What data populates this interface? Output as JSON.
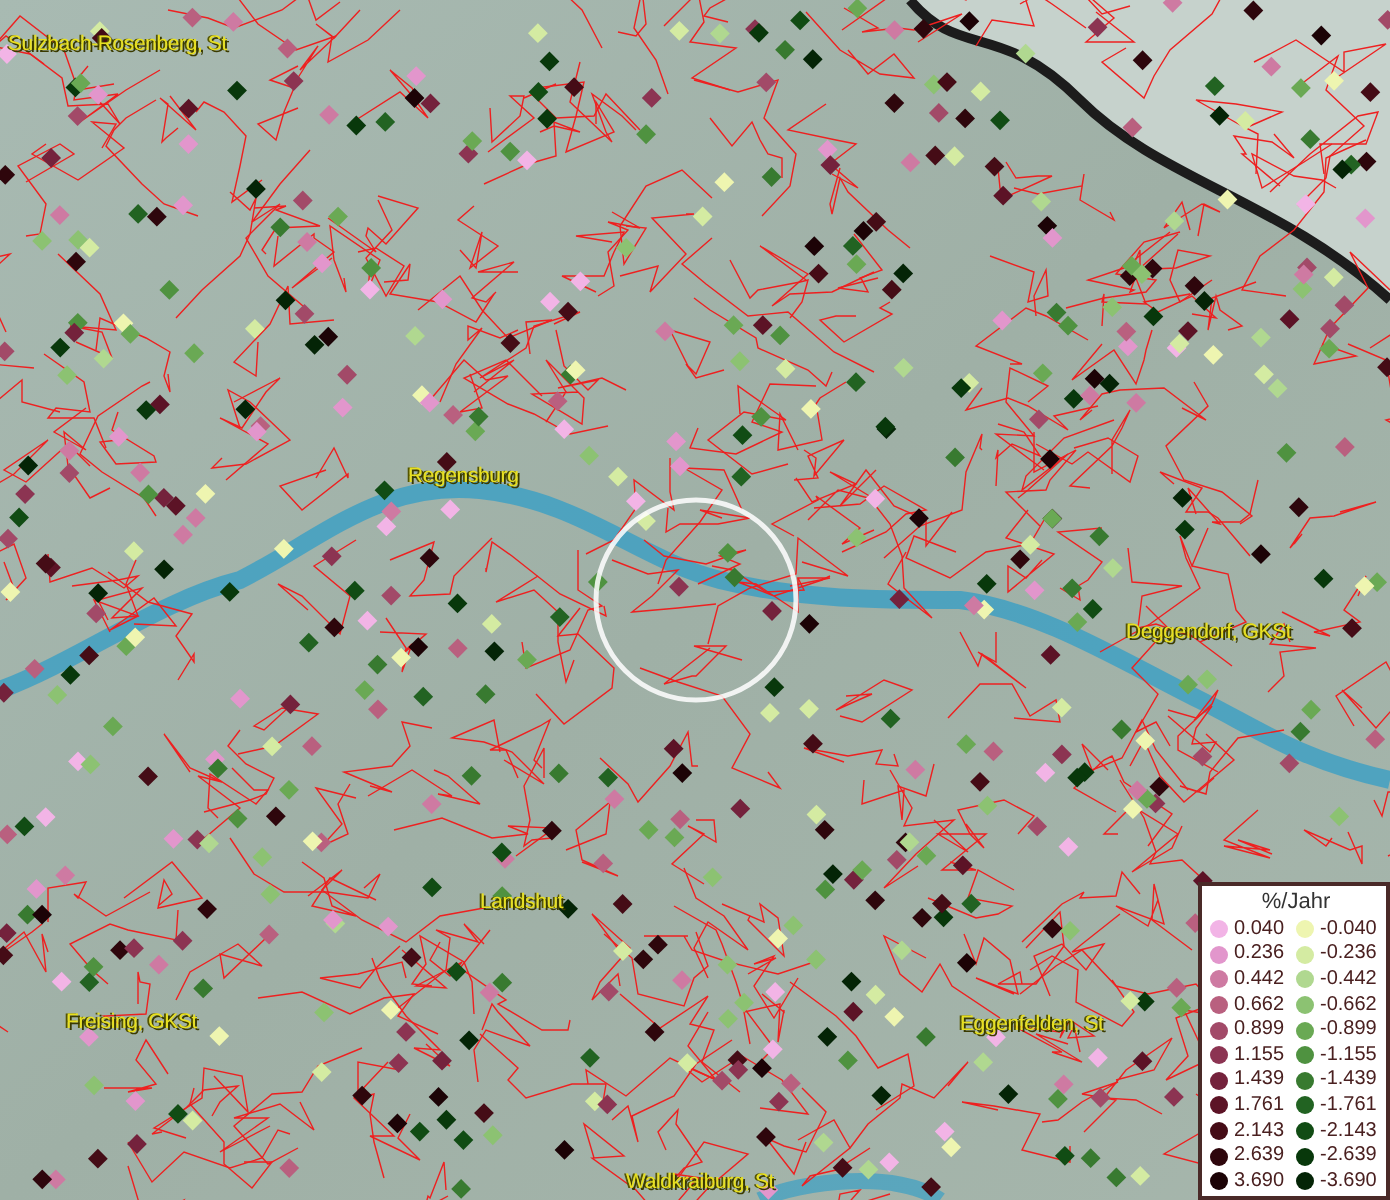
{
  "map": {
    "places": [
      {
        "name": "Sulzbach-Rosenberg, St"
      },
      {
        "name": "Regensburg"
      },
      {
        "name": "Deggendorf, GKSt"
      },
      {
        "name": "Landshut"
      },
      {
        "name": "Freising, GKSt"
      },
      {
        "name": "Eggenfelden, St"
      },
      {
        "name": "Waldkraiburg, St"
      }
    ]
  },
  "legend": {
    "title": "%/Jahr",
    "entries": [
      {
        "value": "0.040",
        "color": "#f2b4e6"
      },
      {
        "value": "-0.040",
        "color": "#eef5b0"
      },
      {
        "value": "0.236",
        "color": "#e296cc"
      },
      {
        "value": "-0.236",
        "color": "#d4eba2"
      },
      {
        "value": "0.442",
        "color": "#ce7aa2"
      },
      {
        "value": "-0.442",
        "color": "#b0d890"
      },
      {
        "value": "0.662",
        "color": "#b9607f"
      },
      {
        "value": "-0.662",
        "color": "#8cc272"
      },
      {
        "value": "0.899",
        "color": "#a24a68"
      },
      {
        "value": "-0.899",
        "color": "#6aa954"
      },
      {
        "value": "1.155",
        "color": "#8c3452"
      },
      {
        "value": "-1.155",
        "color": "#4f9240"
      },
      {
        "value": "1.439",
        "color": "#74223c"
      },
      {
        "value": "-1.439",
        "color": "#387a30"
      },
      {
        "value": "1.761",
        "color": "#5c1326"
      },
      {
        "value": "-1.761",
        "color": "#226322"
      },
      {
        "value": "2.143",
        "color": "#450c16"
      },
      {
        "value": "-2.143",
        "color": "#114c14"
      },
      {
        "value": "2.639",
        "color": "#2e060c"
      },
      {
        "value": "-2.639",
        "color": "#08380b"
      },
      {
        "value": "3.690",
        "color": "#1c0306"
      },
      {
        "value": "-3.690",
        "color": "#042406"
      }
    ]
  }
}
